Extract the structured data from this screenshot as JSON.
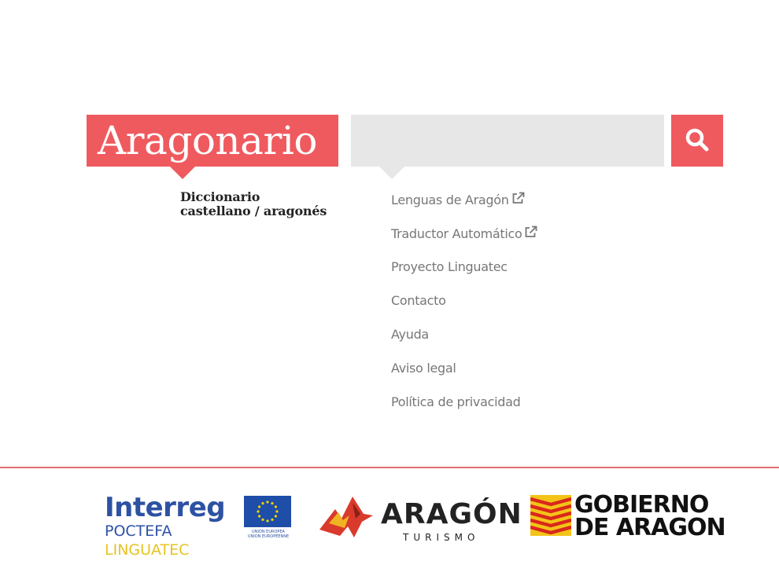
{
  "brand": {
    "title": "Aragonario",
    "subtitle_line1": "Diccionario",
    "subtitle_line2": "castellano / aragonés",
    "accent_color": "#ef5a5f"
  },
  "search": {
    "value": "",
    "placeholder": "",
    "button_icon": "search-icon"
  },
  "nav": {
    "items": [
      {
        "label": "Lenguas de Aragón",
        "external": true
      },
      {
        "label": "Traductor Automático",
        "external": true
      },
      {
        "label": "Proyecto Linguatec",
        "external": false
      },
      {
        "label": "Contacto",
        "external": false
      },
      {
        "label": "Ayuda",
        "external": false
      },
      {
        "label": "Aviso legal",
        "external": false
      },
      {
        "label": "Política de privacidad",
        "external": false
      }
    ]
  },
  "footer": {
    "interreg": {
      "brand": "Interreg",
      "program": "POCTEFA",
      "project": "LINGUATEC",
      "eu_line1": "UNIÓN EUROPEA",
      "eu_line2": "UNION EUROPÉENNE"
    },
    "aragon_turismo": {
      "word": "ARAGÓN",
      "sub": "TURISMO"
    },
    "gobierno": {
      "line1": "GOBIERNO",
      "line2": "DE ARAGON"
    }
  }
}
